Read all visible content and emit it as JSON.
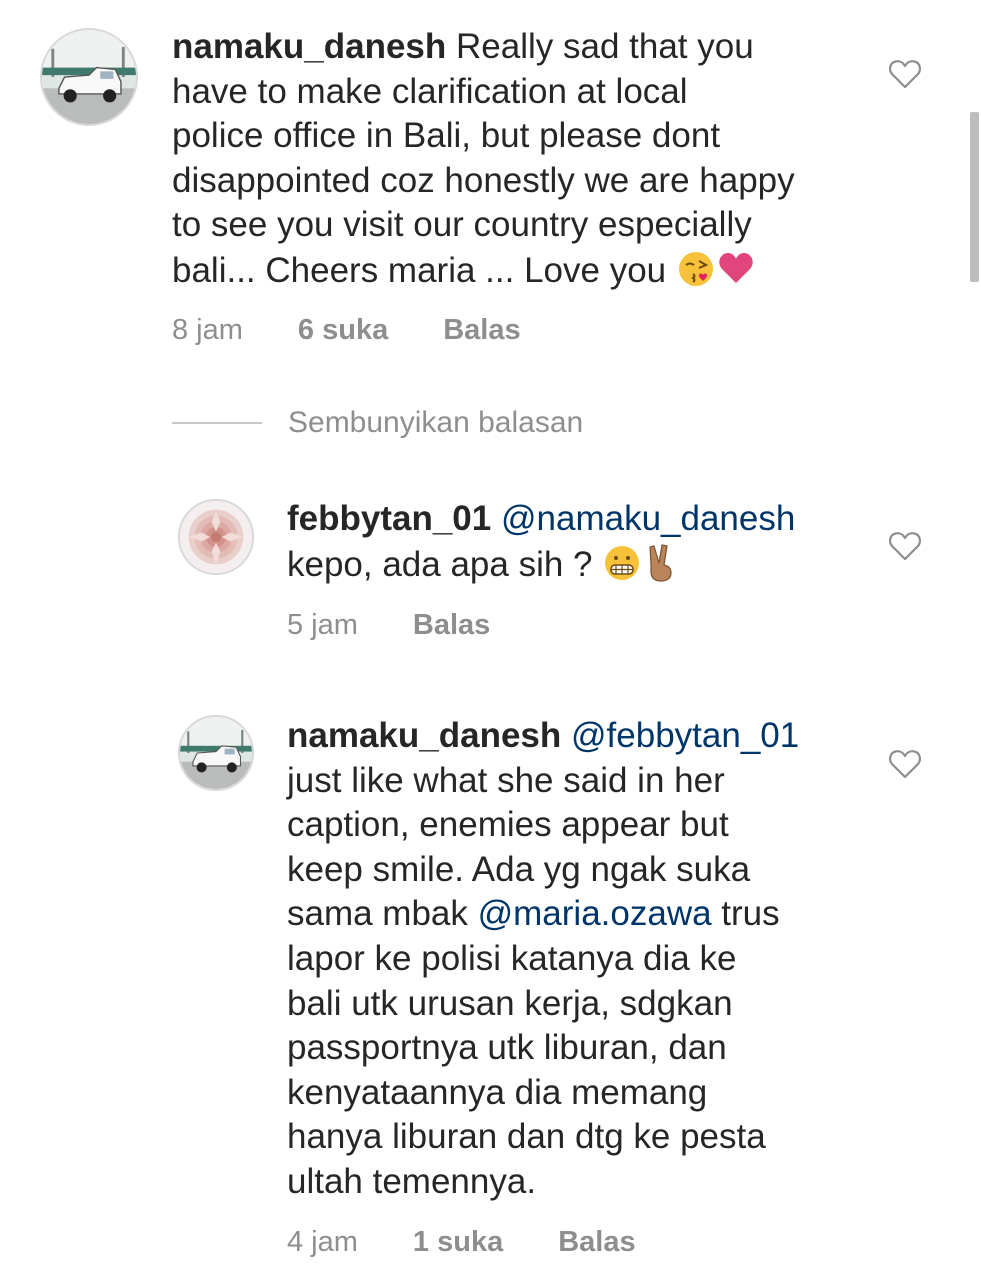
{
  "comments": [
    {
      "username": "namaku_danesh",
      "mention": "",
      "text_before_emoji": "Really sad that you\nhave to make clarification at local\npolice office in Bali, but please dont\ndisappointed coz honestly we are happy\nto see you visit our country especially\nbali... Cheers maria ... Love you ",
      "emojis": [
        "kissing-heart-emoji",
        "pink-heart-emoji"
      ],
      "time": "8 jam",
      "likes": "6 suka",
      "reply_label": "Balas"
    },
    {
      "username": "febbytan_01",
      "mention": "@namaku_danesh",
      "text_before_emoji": "kepo, ada apa sih ? ",
      "emojis": [
        "grimacing-face-emoji",
        "victory-hand-emoji"
      ],
      "time": "5 jam",
      "likes": "",
      "reply_label": "Balas"
    },
    {
      "username": "namaku_danesh",
      "mention": "@febbytan_01",
      "text_part1": "just like what she said in her\ncaption, enemies appear but\nkeep smile. Ada yg ngak suka\nsama mbak ",
      "inline_mention": "@maria.ozawa",
      "text_part2": " trus\nlapor ke polisi katanya dia ke\nbali utk urusan kerja, sdgkan\npassportnya utk liburan, dan\nkenyataannya dia memang\nhanya liburan dan dtg ke pesta\nultah temennya.",
      "time": "4 jam",
      "likes": "1 suka",
      "reply_label": "Balas"
    }
  ],
  "hide_replies_label": "Sembunyikan balasan",
  "colors": {
    "text": "#262626",
    "secondary": "#8e8e8e",
    "mention": "#003569",
    "divider": "#c7c7c7"
  },
  "icons": {
    "like": "heart-outline-icon"
  }
}
